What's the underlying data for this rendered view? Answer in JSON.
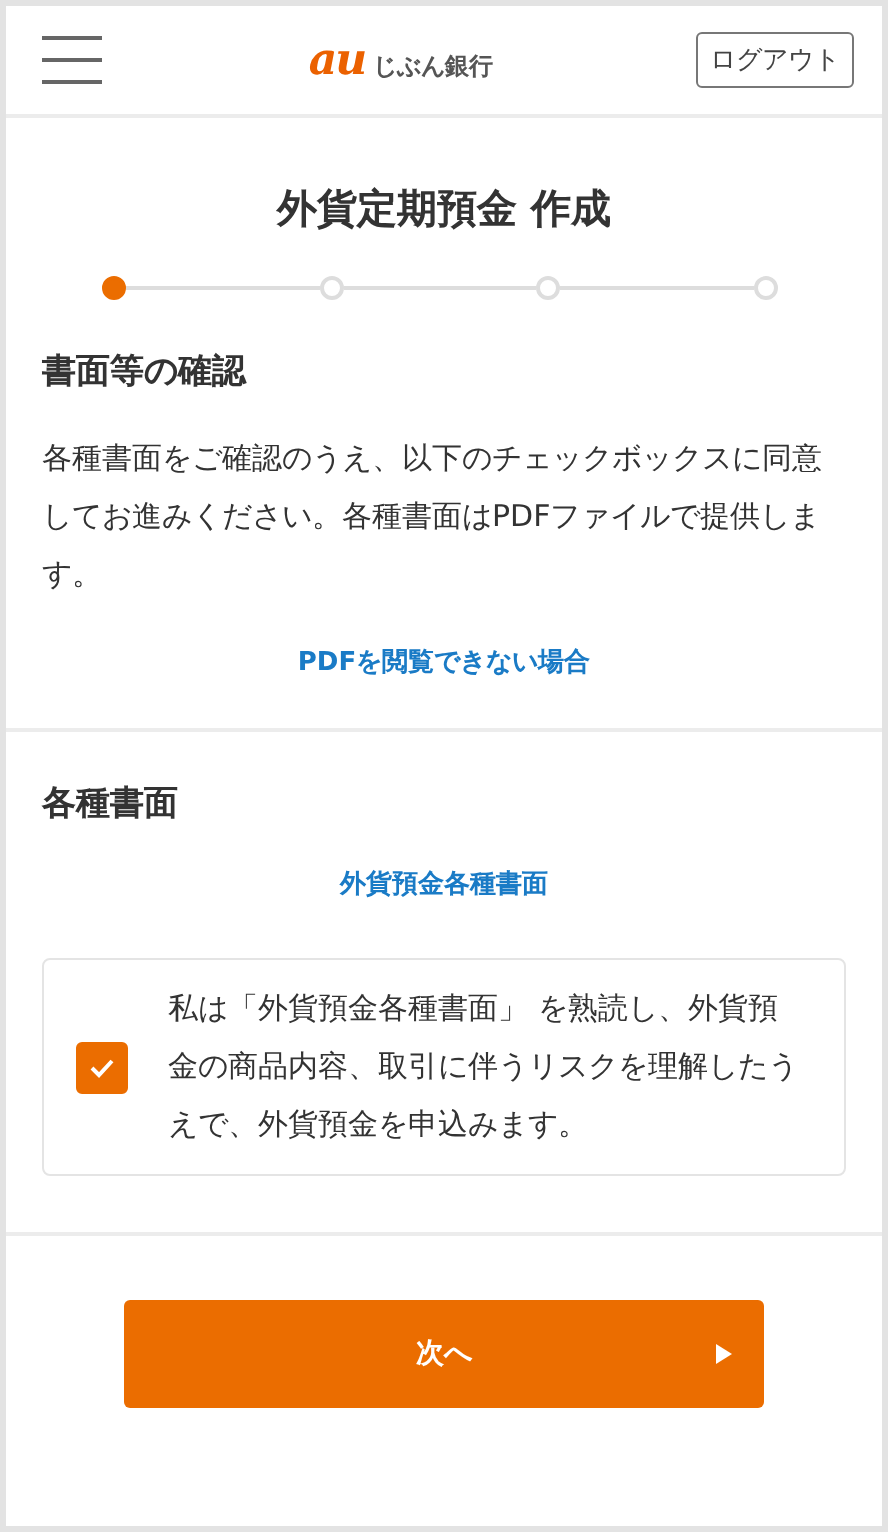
{
  "header": {
    "logo_mark": "au",
    "logo_text": "じぶん銀行",
    "logout": "ログアウト"
  },
  "title": "外貨定期預金 作成",
  "steps": [
    {
      "selected": true
    },
    {
      "selected": false
    },
    {
      "selected": false
    },
    {
      "selected": false
    }
  ],
  "sections": [
    {
      "heading": "書面等の確認",
      "body": "各種書面をご確認のうえ、以下のチェックボックスに同意してお進みください。各種書面はPDFファイルで提供します。",
      "link": "PDFを閲覧できない場合"
    },
    {
      "heading": "各種書面",
      "link": "外貨預金各種書面",
      "agreement": {
        "checked": true,
        "text": "私は「外貨預金各種書面」 を熟読し、外貨預金の商品内容、取引に伴うリスクを理解したうえで、外貨預金を申込みます。"
      }
    }
  ],
  "next_button": "次へ"
}
